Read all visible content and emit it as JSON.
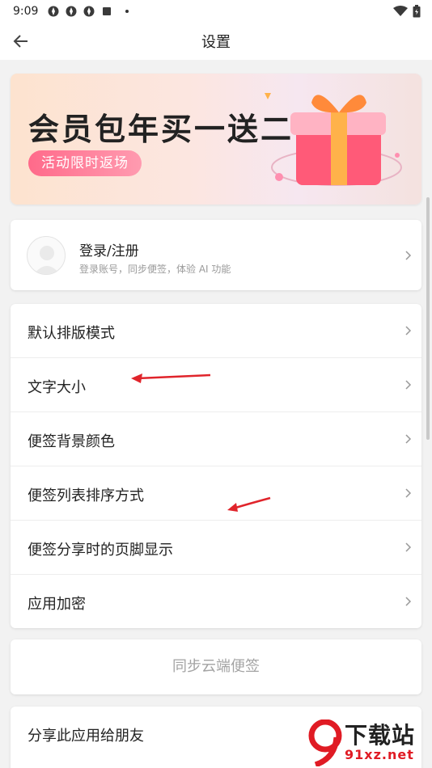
{
  "status_bar": {
    "time": "9:09"
  },
  "app_bar": {
    "title": "设置"
  },
  "banner": {
    "headline": "会员包年买一送二",
    "pill": "活动限时返场"
  },
  "login": {
    "title": "登录/注册",
    "subtitle": "登录账号，同步便签，体验 AI 功能"
  },
  "settings": {
    "items": [
      {
        "label": "默认排版模式"
      },
      {
        "label": "文字大小"
      },
      {
        "label": "便签背景颜色"
      },
      {
        "label": "便签列表排序方式"
      },
      {
        "label": "便签分享时的页脚显示"
      },
      {
        "label": "应用加密"
      }
    ]
  },
  "sync": {
    "label": "同步云端便签"
  },
  "share": {
    "label": "分享此应用给朋友"
  },
  "watermark": {
    "text1": "下载站",
    "text2": "91xz.net"
  },
  "colors": {
    "accent": "#ff6a8a",
    "annotation_arrow": "#e0242b"
  }
}
